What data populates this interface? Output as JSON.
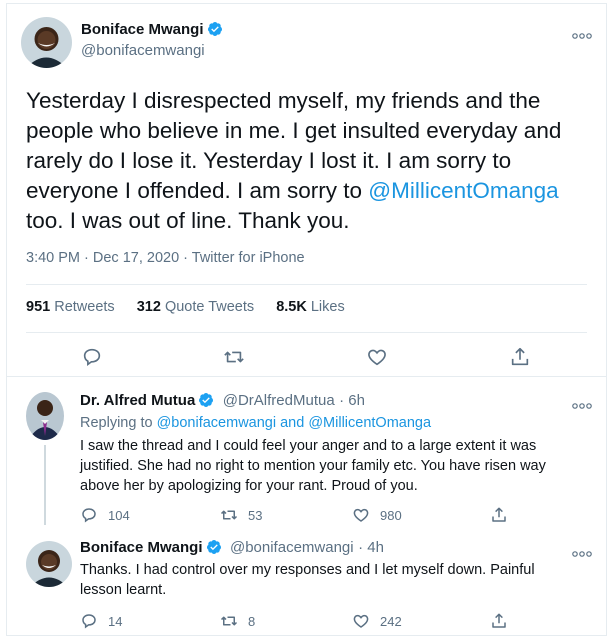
{
  "main_tweet": {
    "author_name": "Boniface Mwangi",
    "author_handle": "@bonifacemwangi",
    "text_part1": "Yesterday I disrespected myself, my friends and the people who believe in me. I get insulted everyday and rarely do I lose it. Yesterday I lost it. I am sorry to everyone I offended. I am sorry to ",
    "mention": "@MillicentOmanga",
    "text_part2": " too. I was out of line. Thank you.",
    "timestamp": "3:40 PM · Dec 17, 2020 · Twitter for iPhone",
    "retweets_count": "951",
    "retweets_label": "Retweets",
    "quotes_count": "312",
    "quotes_label": "Quote Tweets",
    "likes_count": "8.5K",
    "likes_label": "Likes"
  },
  "replies": [
    {
      "author_name": "Dr. Alfred Mutua",
      "author_handle": "@DrAlfredMutua",
      "time": "· 6h",
      "replying_label": "Replying to ",
      "replying_to": "@bonifacemwangi and @MillicentOmanga",
      "text": "I saw the thread and I could feel your anger and to a large extent it was justified. She had no right to mention your family etc. You have risen way above her by apologizing for your rant. Proud of you.",
      "replies_count": "104",
      "retweets_count": "53",
      "likes_count": "980"
    },
    {
      "author_name": "Boniface Mwangi",
      "author_handle": "@bonifacemwangi",
      "time": "· 4h",
      "text": "Thanks. I had control over my responses and I let myself down. Painful lesson learnt.",
      "replies_count": "14",
      "retweets_count": "8",
      "likes_count": "242"
    }
  ],
  "colors": {
    "accent": "#1b95e0",
    "verified": "#1da1f2",
    "secondary_text": "#5b7083",
    "divider": "#e6ecf0"
  },
  "icons": [
    "verified-badge-icon",
    "more-options-icon",
    "reply-icon",
    "retweet-icon",
    "like-icon",
    "share-icon"
  ]
}
